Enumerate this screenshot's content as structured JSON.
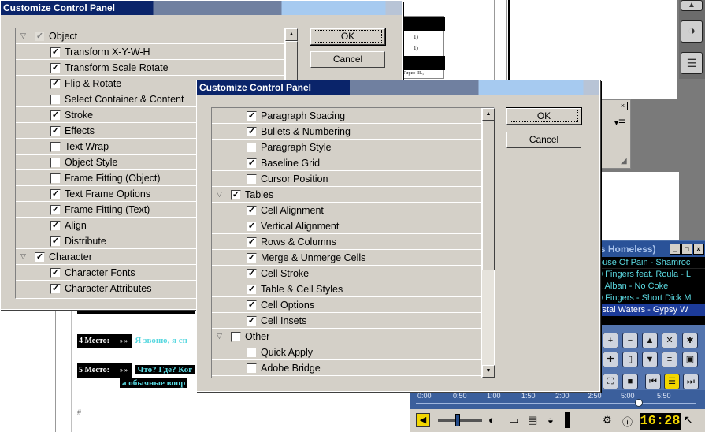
{
  "dialog_back": {
    "title": "Customize Control Panel",
    "ok": "OK",
    "cancel": "Cancel",
    "rows": [
      {
        "label": "Object",
        "checked": true,
        "group": true,
        "expanded": true,
        "grey": true
      },
      {
        "label": "Transform X-Y-W-H",
        "checked": true
      },
      {
        "label": "Transform Scale Rotate",
        "checked": true
      },
      {
        "label": "Flip & Rotate",
        "checked": true
      },
      {
        "label": "Select Container & Content",
        "checked": false
      },
      {
        "label": "Stroke",
        "checked": true
      },
      {
        "label": "Effects",
        "checked": true
      },
      {
        "label": "Text Wrap",
        "checked": false
      },
      {
        "label": "Object Style",
        "checked": false
      },
      {
        "label": "Frame Fitting (Object)",
        "checked": false
      },
      {
        "label": "Text Frame Options",
        "checked": true
      },
      {
        "label": "Frame Fitting (Text)",
        "checked": true
      },
      {
        "label": "Align",
        "checked": true
      },
      {
        "label": "Distribute",
        "checked": true
      },
      {
        "label": "Character",
        "checked": true,
        "group": true,
        "expanded": true
      },
      {
        "label": "Character Fonts",
        "checked": true
      },
      {
        "label": "Character Attributes",
        "checked": true
      }
    ]
  },
  "dialog_front": {
    "title": "Customize Control Panel",
    "ok": "OK",
    "cancel": "Cancel",
    "rows": [
      {
        "label": "Paragraph Spacing",
        "checked": true
      },
      {
        "label": "Bullets & Numbering",
        "checked": true
      },
      {
        "label": "Paragraph Style",
        "checked": false
      },
      {
        "label": "Baseline Grid",
        "checked": true
      },
      {
        "label": "Cursor Position",
        "checked": false
      },
      {
        "label": "Tables",
        "checked": true,
        "group": true,
        "expanded": true
      },
      {
        "label": "Cell Alignment",
        "checked": true
      },
      {
        "label": "Vertical Alignment",
        "checked": true
      },
      {
        "label": "Rows & Columns",
        "checked": true
      },
      {
        "label": "Merge & Unmerge Cells",
        "checked": true
      },
      {
        "label": "Cell Stroke",
        "checked": true
      },
      {
        "label": "Table & Cell Styles",
        "checked": true
      },
      {
        "label": "Cell Options",
        "checked": true
      },
      {
        "label": "Cell Insets",
        "checked": true
      },
      {
        "label": "Other",
        "checked": false,
        "group": true,
        "expanded": true
      },
      {
        "label": "Quick Apply",
        "checked": false
      },
      {
        "label": "Adobe Bridge",
        "checked": false
      }
    ]
  },
  "document": {
    "place4_label": "4 Место:",
    "place4_arrows": "» »",
    "place4_text": "Я звоню, я сп",
    "place5_label": "5 Место:",
    "place5_arrows": "» »",
    "place5_text": "Что? Где? Ког",
    "place5_text2": "а обычные вопр",
    "table_cell1": "1)",
    "table_cell2": "1)",
    "table_tip": "Гирис III.,"
  },
  "player": {
    "title": "'s Homeless)",
    "playlist": [
      {
        "text": "ouse Of Pain - Shamroc",
        "selected": false
      },
      {
        "text": "0 Fingers feat. Roula - L",
        "selected": false
      },
      {
        "text": "r. Alban - No Coke",
        "selected": false
      },
      {
        "text": "0 Fingers - Short Dick M",
        "selected": false
      },
      {
        "text": "ystal Waters - Gypsy W",
        "selected": true
      }
    ],
    "timeline_ticks": [
      "0:00",
      "0:50",
      "1:00",
      "1:50",
      "2:00",
      "2:50",
      "5:00",
      "5:50"
    ],
    "clock": "16:28"
  },
  "colors": {
    "dialog_bg": "#d4d0c8",
    "title_active": "#0a246a",
    "player_bg": "#4a6ea8",
    "playlist_text": "#5ad8e0",
    "clock_text": "#f2d600"
  }
}
